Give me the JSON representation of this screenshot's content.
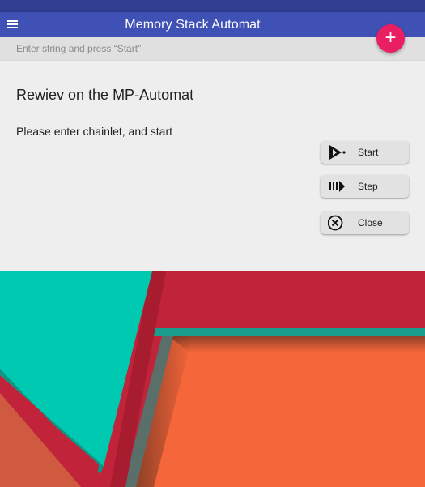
{
  "app": {
    "title": "Memory Stack Automat",
    "menu_icon": "hamburger-menu-icon",
    "fab": {
      "label": "+",
      "icon": "plus-icon",
      "color": "#e91e63"
    }
  },
  "input": {
    "placeholder": "Enter string and press “Start”",
    "value": ""
  },
  "main": {
    "heading": "Rewiev on the MP-Automat",
    "prompt": "Please enter chainlet, and start"
  },
  "actions": [
    {
      "label": "Start",
      "icon": "play-icon"
    },
    {
      "label": "Step",
      "icon": "step-forward-icon"
    },
    {
      "label": "Close",
      "icon": "close-circle-icon"
    }
  ],
  "colors": {
    "primary": "#3f51b5",
    "primary_dark": "#2f3e8f",
    "accent": "#e91e63",
    "background": "#eeeeee",
    "art_teal": "#00c9b1",
    "art_red": "#c0233a",
    "art_orange": "#f5663a"
  }
}
